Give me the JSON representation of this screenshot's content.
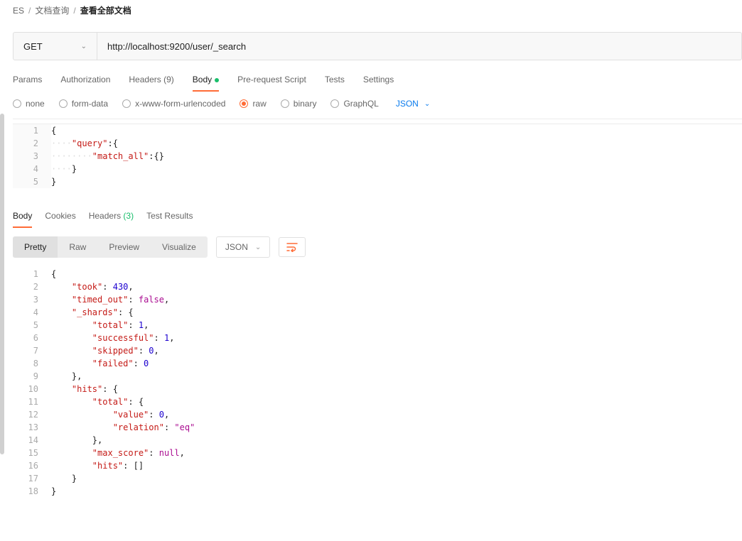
{
  "breadcrumb": {
    "items": [
      "ES",
      "文档查询",
      "查看全部文档"
    ]
  },
  "request": {
    "method": "GET",
    "url": "http://localhost:9200/user/_search"
  },
  "req_tabs": {
    "params": "Params",
    "auth": "Authorization",
    "headers_label": "Headers",
    "headers_count": "(9)",
    "body": "Body",
    "prereq": "Pre-request Script",
    "tests": "Tests",
    "settings": "Settings"
  },
  "body_types": {
    "none": "none",
    "form": "form-data",
    "xwww": "x-www-form-urlencoded",
    "raw": "raw",
    "binary": "binary",
    "graphql": "GraphQL",
    "lang": "JSON"
  },
  "req_body_lines": [
    {
      "ind": 0,
      "tokens": [
        {
          "c": "p",
          "t": "{"
        }
      ]
    },
    {
      "ind": 1,
      "tokens": [
        {
          "c": "k",
          "t": "\"query\""
        },
        {
          "c": "p",
          "t": ":{"
        }
      ]
    },
    {
      "ind": 2,
      "tokens": [
        {
          "c": "k",
          "t": "\"match_all\""
        },
        {
          "c": "p",
          "t": ":{}"
        }
      ]
    },
    {
      "ind": 1,
      "tokens": [
        {
          "c": "p",
          "t": "}"
        }
      ]
    },
    {
      "ind": 0,
      "tokens": [
        {
          "c": "p",
          "t": "}"
        }
      ]
    }
  ],
  "resp_tabs": {
    "body": "Body",
    "cookies": "Cookies",
    "headers_label": "Headers",
    "headers_count": "(3)",
    "tests": "Test Results"
  },
  "view_modes": {
    "pretty": "Pretty",
    "raw": "Raw",
    "preview": "Preview",
    "visualize": "Visualize",
    "fmt": "JSON"
  },
  "resp_body_lines": [
    {
      "ind": 0,
      "tokens": [
        {
          "c": "p",
          "t": "{"
        }
      ]
    },
    {
      "ind": 1,
      "tokens": [
        {
          "c": "k",
          "t": "\"took\""
        },
        {
          "c": "p",
          "t": ": "
        },
        {
          "c": "n",
          "t": "430"
        },
        {
          "c": "p",
          "t": ","
        }
      ]
    },
    {
      "ind": 1,
      "tokens": [
        {
          "c": "k",
          "t": "\"timed_out\""
        },
        {
          "c": "p",
          "t": ": "
        },
        {
          "c": "b",
          "t": "false"
        },
        {
          "c": "p",
          "t": ","
        }
      ]
    },
    {
      "ind": 1,
      "tokens": [
        {
          "c": "k",
          "t": "\"_shards\""
        },
        {
          "c": "p",
          "t": ": {"
        }
      ]
    },
    {
      "ind": 2,
      "tokens": [
        {
          "c": "k",
          "t": "\"total\""
        },
        {
          "c": "p",
          "t": ": "
        },
        {
          "c": "n",
          "t": "1"
        },
        {
          "c": "p",
          "t": ","
        }
      ]
    },
    {
      "ind": 2,
      "tokens": [
        {
          "c": "k",
          "t": "\"successful\""
        },
        {
          "c": "p",
          "t": ": "
        },
        {
          "c": "n",
          "t": "1"
        },
        {
          "c": "p",
          "t": ","
        }
      ]
    },
    {
      "ind": 2,
      "tokens": [
        {
          "c": "k",
          "t": "\"skipped\""
        },
        {
          "c": "p",
          "t": ": "
        },
        {
          "c": "n",
          "t": "0"
        },
        {
          "c": "p",
          "t": ","
        }
      ]
    },
    {
      "ind": 2,
      "tokens": [
        {
          "c": "k",
          "t": "\"failed\""
        },
        {
          "c": "p",
          "t": ": "
        },
        {
          "c": "n",
          "t": "0"
        }
      ]
    },
    {
      "ind": 1,
      "tokens": [
        {
          "c": "p",
          "t": "},"
        }
      ]
    },
    {
      "ind": 1,
      "tokens": [
        {
          "c": "k",
          "t": "\"hits\""
        },
        {
          "c": "p",
          "t": ": {"
        }
      ]
    },
    {
      "ind": 2,
      "tokens": [
        {
          "c": "k",
          "t": "\"total\""
        },
        {
          "c": "p",
          "t": ": {"
        }
      ]
    },
    {
      "ind": 3,
      "tokens": [
        {
          "c": "k",
          "t": "\"value\""
        },
        {
          "c": "p",
          "t": ": "
        },
        {
          "c": "n",
          "t": "0"
        },
        {
          "c": "p",
          "t": ","
        }
      ]
    },
    {
      "ind": 3,
      "tokens": [
        {
          "c": "k",
          "t": "\"relation\""
        },
        {
          "c": "p",
          "t": ": "
        },
        {
          "c": "b",
          "t": "\"eq\""
        }
      ]
    },
    {
      "ind": 2,
      "tokens": [
        {
          "c": "p",
          "t": "},"
        }
      ]
    },
    {
      "ind": 2,
      "tokens": [
        {
          "c": "k",
          "t": "\"max_score\""
        },
        {
          "c": "p",
          "t": ": "
        },
        {
          "c": "b",
          "t": "null"
        },
        {
          "c": "p",
          "t": ","
        }
      ]
    },
    {
      "ind": 2,
      "tokens": [
        {
          "c": "k",
          "t": "\"hits\""
        },
        {
          "c": "p",
          "t": ": []"
        }
      ]
    },
    {
      "ind": 1,
      "tokens": [
        {
          "c": "p",
          "t": "}"
        }
      ]
    },
    {
      "ind": 0,
      "tokens": [
        {
          "c": "p",
          "t": "}"
        }
      ]
    }
  ]
}
